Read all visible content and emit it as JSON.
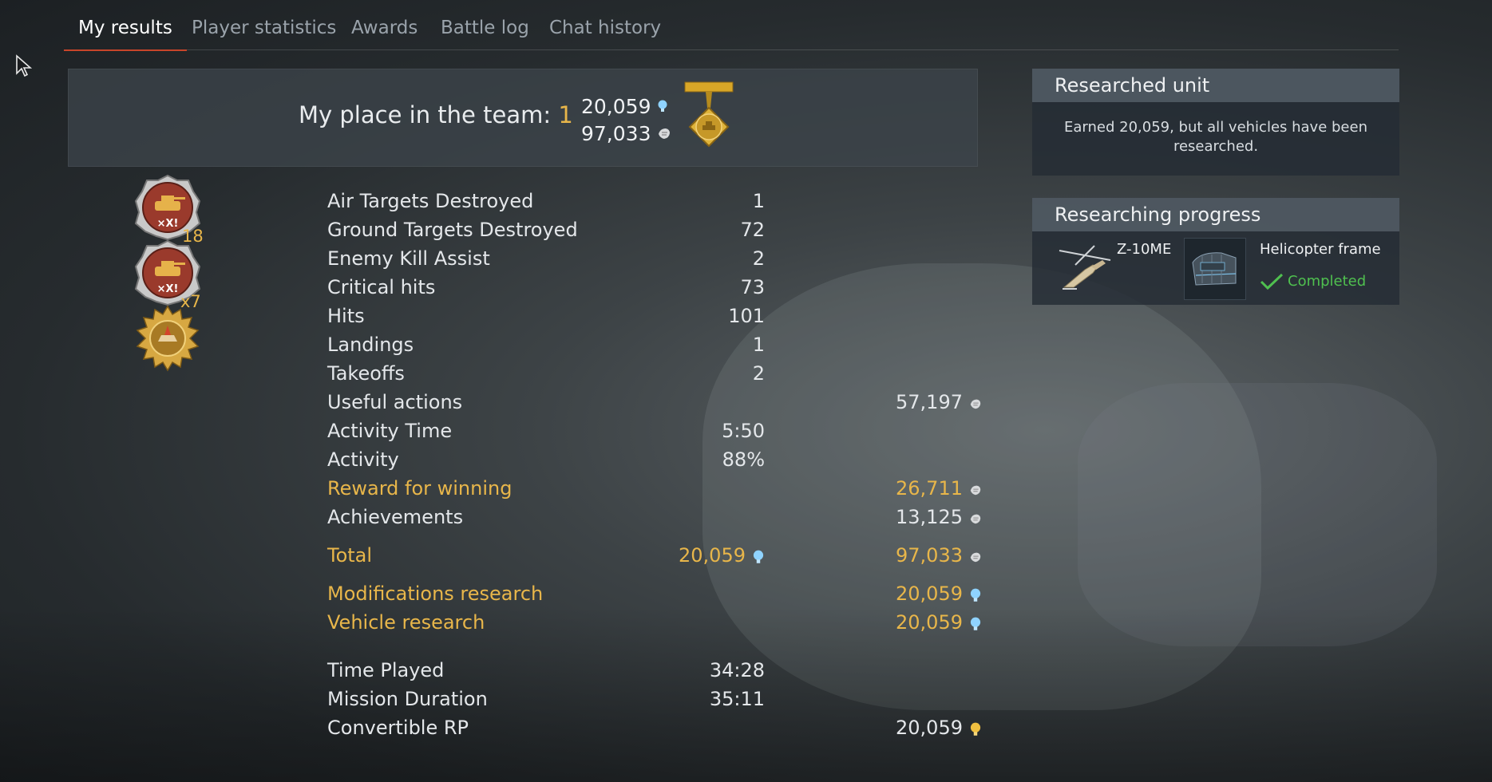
{
  "tabs": [
    {
      "label": "My results",
      "active": true
    },
    {
      "label": "Player statistics"
    },
    {
      "label": "Awards"
    },
    {
      "label": "Battle log"
    },
    {
      "label": "Chat history"
    }
  ],
  "summary": {
    "place_label": "My place in the team:",
    "place_value": "1",
    "research_points": "20,059",
    "silver_lions": "97,033"
  },
  "awards": [
    {
      "icon": "tank-kills-streak-medal",
      "count": "18"
    },
    {
      "icon": "tank-kills-streak-medal",
      "count": "x7"
    },
    {
      "icon": "gold-tank-medal",
      "count": ""
    }
  ],
  "stats": [
    {
      "label": "Air Targets Destroyed",
      "value": "1"
    },
    {
      "label": "Ground Targets Destroyed",
      "value": "72"
    },
    {
      "label": "Enemy Kill Assist",
      "value": "2"
    },
    {
      "label": "Critical hits",
      "value": "73"
    },
    {
      "label": "Hits",
      "value": "101"
    },
    {
      "label": "Landings",
      "value": "1"
    },
    {
      "label": "Takeoffs",
      "value": "2"
    },
    {
      "label": "Useful actions",
      "reward": "57,197"
    },
    {
      "label": "Activity Time",
      "value": "5:50"
    },
    {
      "label": "Activity",
      "value": "88%"
    },
    {
      "label": "Reward for winning",
      "reward": "26,711"
    },
    {
      "label": "Achievements",
      "reward": "13,125"
    },
    {
      "label": "Total",
      "value": "20,059",
      "reward": "97,033"
    },
    {
      "label": "Modifications research",
      "reward": "20,059"
    },
    {
      "label": "Vehicle research",
      "reward": "20,059"
    },
    {
      "label": "Time Played",
      "value": "34:28"
    },
    {
      "label": "Mission Duration",
      "value": "35:11"
    },
    {
      "label": "Convertible RP",
      "reward": "20,059"
    }
  ],
  "researched_unit": {
    "title": "Researched unit",
    "text": "Earned 20,059, but all vehicles have been researched."
  },
  "researching_progress": {
    "title": "Researching progress",
    "vehicle": "Z-10ME",
    "module": "Helicopter frame",
    "status": "Completed"
  },
  "colors": {
    "accent_gold": "#e8b64a",
    "tab_underline": "#c8452a",
    "completed_green": "#4fc04f",
    "rp_blue": "#8fd3ff"
  }
}
